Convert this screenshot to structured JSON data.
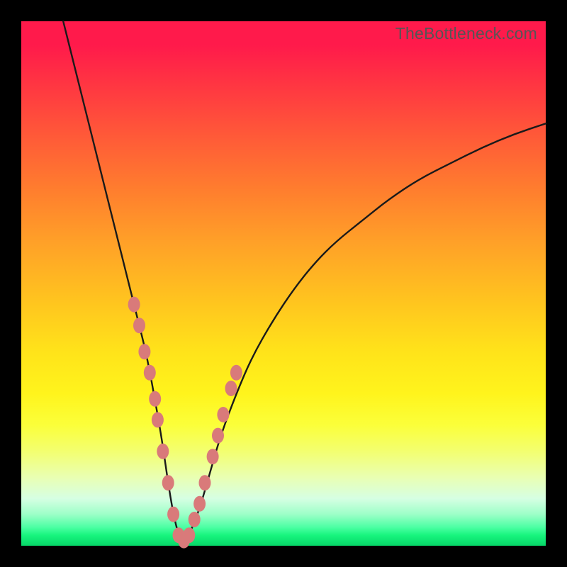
{
  "watermark": "TheBottleneck.com",
  "colors": {
    "curve_stroke": "#1a1a1a",
    "marker_fill": "#d97a7a",
    "marker_stroke": "#c26060"
  },
  "chart_data": {
    "type": "line",
    "title": "",
    "xlabel": "",
    "ylabel": "",
    "xlim": [
      0,
      100
    ],
    "ylim": [
      0,
      100
    ],
    "series": [
      {
        "name": "bottleneck-curve",
        "x": [
          8,
          10,
          12,
          14,
          16,
          18,
          20,
          22,
          24,
          26,
          27,
          28,
          29,
          30,
          31,
          32,
          34,
          36,
          38,
          41,
          44,
          48,
          52,
          56,
          60,
          65,
          70,
          76,
          82,
          88,
          94,
          100
        ],
        "y": [
          100,
          92,
          84,
          76,
          68,
          60,
          52,
          44,
          36,
          25,
          19,
          12,
          6,
          2,
          1,
          2,
          7,
          14,
          21,
          29,
          36,
          43,
          49,
          54,
          58,
          62,
          66,
          70,
          73,
          76,
          78.5,
          80.5
        ]
      }
    ],
    "markers": {
      "name": "highlight-points",
      "x": [
        21.5,
        22.5,
        23.5,
        24.5,
        25.5,
        26.0,
        27.0,
        28.0,
        29.0,
        30.0,
        31.0,
        32.0,
        33.0,
        34.0,
        35.0,
        36.5,
        37.5,
        38.5,
        40.0,
        41.0
      ],
      "y": [
        46,
        42,
        37,
        33,
        28,
        24,
        18,
        12,
        6,
        2,
        1,
        2,
        5,
        8,
        12,
        17,
        21,
        25,
        30,
        33
      ]
    }
  }
}
